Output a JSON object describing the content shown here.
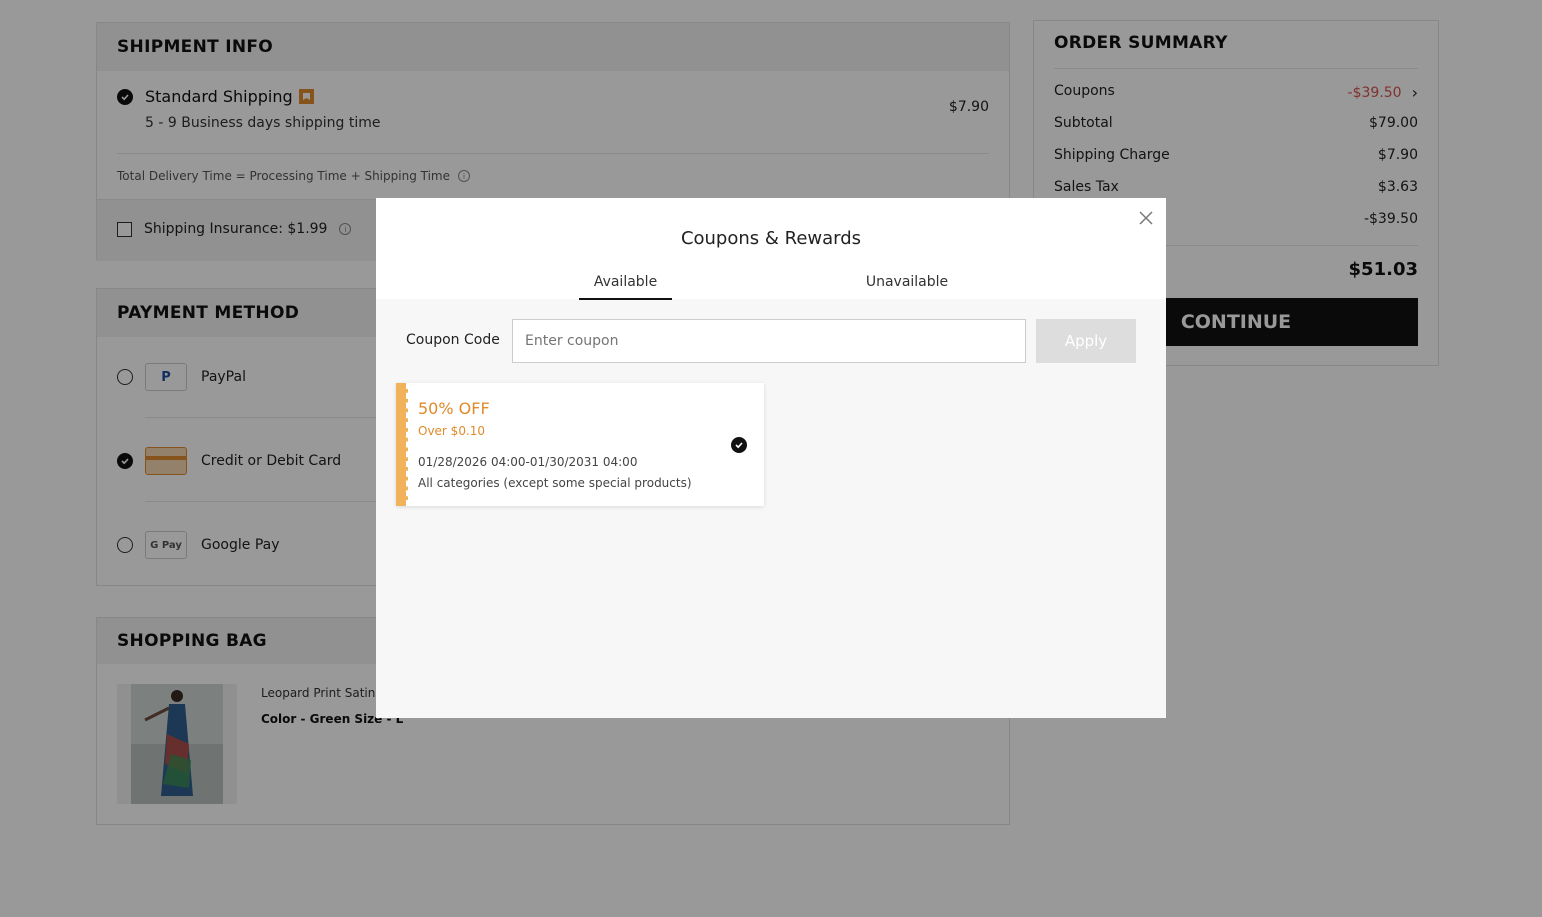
{
  "colors": {
    "accent": "#e08a2c",
    "negative": "#d9534f",
    "dark": "#111111"
  },
  "shipment": {
    "title": "SHIPMENT INFO",
    "method": "Standard Shipping",
    "method_icon": "bookmark-badge-icon",
    "method_time": "5 - 9 Business days shipping time",
    "method_price": "$7.90",
    "delivery_note": "Total Delivery Time = Processing Time + Shipping Time",
    "insurance_label": "Shipping Insurance: $1.99"
  },
  "payment": {
    "title": "PAYMENT METHOD",
    "options": [
      {
        "label": "PayPal",
        "logo": "P",
        "selected": false
      },
      {
        "label": "Credit or Debit Card",
        "logo": "card",
        "selected": true
      },
      {
        "label": "Google Pay",
        "logo": "G Pay",
        "selected": false
      }
    ]
  },
  "bag": {
    "title": "SHOPPING BAG",
    "item_name": "Leopard Print Satin",
    "item_attrs": "Color - Green  Size - L"
  },
  "summary": {
    "title": "ORDER SUMMARY",
    "coupons_label": "Coupons",
    "coupons_value": "-$39.50",
    "subtotal_label": "Subtotal",
    "subtotal_value": "$79.00",
    "shipping_label": "Shipping Charge",
    "shipping_value": "$7.90",
    "tax_label": "Sales Tax",
    "tax_value": "$3.63",
    "discount_value": "-$39.50",
    "total_value": "$51.03",
    "continue_label": "CONTINUE"
  },
  "modal": {
    "title": "Coupons & Rewards",
    "tabs": [
      "Available",
      "Unavailable"
    ],
    "code_label": "Coupon Code",
    "input_placeholder": "Enter coupon",
    "apply_label": "Apply",
    "coupon": {
      "title": "50% OFF",
      "condition": "Over $0.10",
      "validity": "01/28/2026 04:00-01/30/2031 04:00",
      "scope": "All categories (except some special products)"
    }
  }
}
